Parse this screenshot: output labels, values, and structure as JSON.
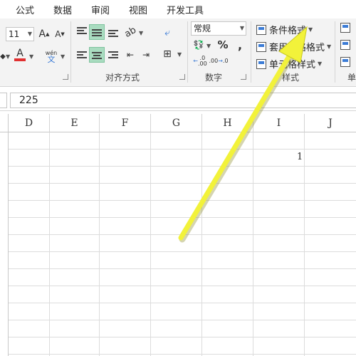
{
  "menu": {
    "tabs": [
      "公式",
      "数据",
      "审阅",
      "视图",
      "开发工具"
    ]
  },
  "ribbon": {
    "font": {
      "size_value": "11",
      "phonetic_label": "wén"
    },
    "alignment": {
      "group_label": "对齐方式"
    },
    "number": {
      "format_value": "常规",
      "percent_symbol": "%",
      "comma_symbol": ",",
      "increase_decimal": "←.0\n.00",
      "decrease_decimal": ".00\n→.0",
      "group_label": "数字"
    },
    "styles": {
      "conditional_format": "条件格式",
      "table_format": "套用表格格式",
      "cell_style": "单元格样式",
      "group_label": "样式"
    },
    "cells_partial_label": "单"
  },
  "formula_bar": {
    "value": "225"
  },
  "columns": [
    "D",
    "E",
    "F",
    "G",
    "H",
    "I",
    "J"
  ],
  "cells": [
    {
      "column": "I",
      "row_index": 1,
      "value": "1"
    }
  ],
  "colors": {
    "highlight_arrow": "#f2f23a",
    "selected_align": "#a9dcc0",
    "font_color_bar": "#e03030"
  }
}
